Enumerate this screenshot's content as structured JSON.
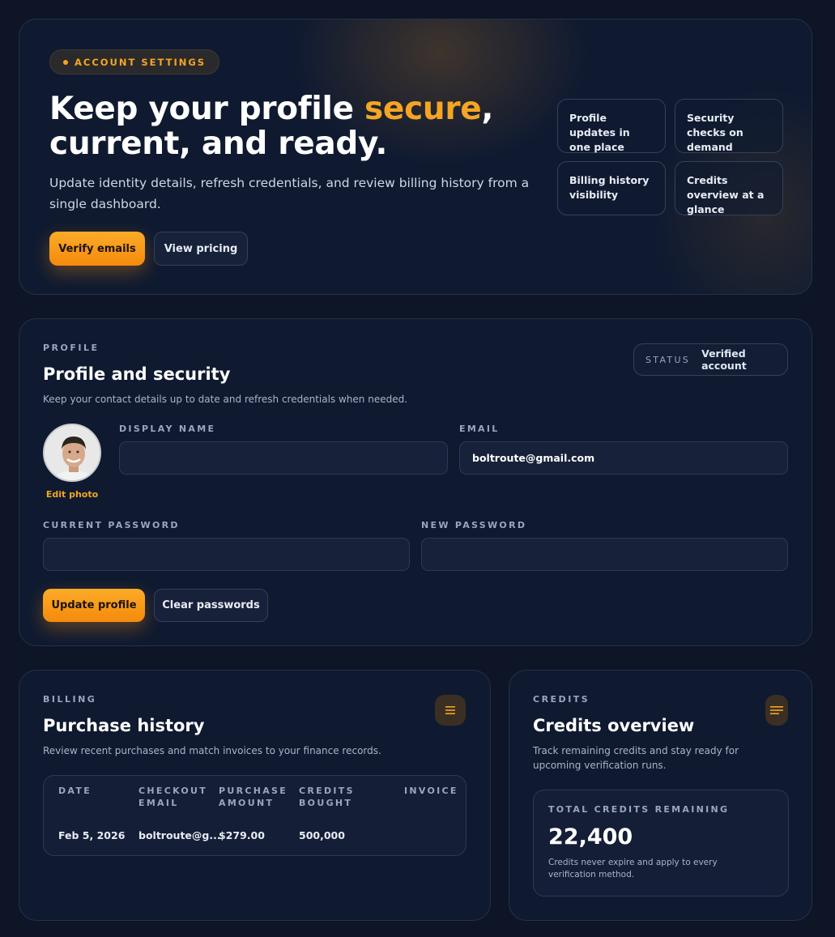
{
  "hero": {
    "badge": "ACCOUNT SETTINGS",
    "title_start": "Keep your profile ",
    "title_accent": "secure",
    "title_end": ", current, and ready.",
    "subtitle": "Update identity details, refresh credentials, and review billing history from a single dashboard.",
    "primary_button": "Verify emails",
    "secondary_button": "View pricing",
    "features": [
      "Profile updates in one place",
      "Security checks on demand",
      "Billing history visibility",
      "Credits overview at a glance"
    ]
  },
  "profile": {
    "eyebrow": "PROFILE",
    "title": "Profile and security",
    "description": "Keep your contact details up to date and refresh credentials when needed.",
    "status_label": "STATUS",
    "status_value": "Verified account",
    "edit_photo": "Edit photo",
    "display_name_label": "DISPLAY NAME",
    "display_name_value": "",
    "email_label": "EMAIL",
    "email_value": "boltroute@gmail.com",
    "current_password_label": "CURRENT PASSWORD",
    "new_password_label": "NEW PASSWORD",
    "update_button": "Update profile",
    "clear_button": "Clear passwords"
  },
  "billing": {
    "eyebrow": "BILLING",
    "title": "Purchase history",
    "description": "Review recent purchases and match invoices to your finance records.",
    "columns": [
      "DATE",
      "CHECKOUT EMAIL",
      "PURCHASE AMOUNT",
      "CREDITS BOUGHT",
      "INVOICE"
    ],
    "rows": [
      {
        "date": "Feb 5, 2026",
        "email": "boltroute@g...",
        "amount": "$279.00",
        "credits": "500,000",
        "invoice": ""
      }
    ]
  },
  "credits": {
    "eyebrow": "CREDITS",
    "title": "Credits overview",
    "description": "Track remaining credits and stay ready for upcoming verification runs.",
    "total_label": "TOTAL CREDITS REMAINING",
    "total_value": "22,400",
    "note": "Credits never expire and apply to every verification method."
  },
  "colors": {
    "accent": "#f5a524",
    "background": "#0d1526",
    "card": "#0f1a30"
  },
  "icons": {
    "menu": "menu-icon",
    "status_dot": "dot-icon"
  }
}
